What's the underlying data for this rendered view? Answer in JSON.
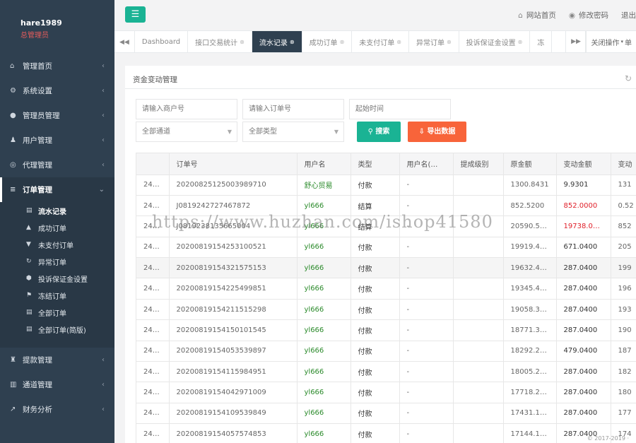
{
  "profile": {
    "name": "hare1989",
    "role": "总管理员"
  },
  "menu": [
    {
      "icon": "home-icon",
      "glyph": "⌂",
      "label": "管理首页"
    },
    {
      "icon": "settings-icon",
      "glyph": "⚙",
      "label": "系统设置"
    },
    {
      "icon": "user-circle-icon",
      "glyph": "●",
      "label": "管理员管理"
    },
    {
      "icon": "users-icon",
      "glyph": "♟",
      "label": "用户管理"
    },
    {
      "icon": "agent-icon",
      "glyph": "◎",
      "label": "代理管理"
    }
  ],
  "orders_menu": {
    "icon": "list-icon",
    "glyph": "≡",
    "label": "订单管理"
  },
  "submenu": [
    {
      "icon": "list-alt-icon",
      "glyph": "▤",
      "label": "流水记录"
    },
    {
      "icon": "thumbs-up-icon",
      "glyph": "▲",
      "label": "成功订单"
    },
    {
      "icon": "thumbs-down-icon",
      "glyph": "▼",
      "label": "未支付订单"
    },
    {
      "icon": "refresh-icon",
      "glyph": "↻",
      "label": "异常订单"
    },
    {
      "icon": "shield-icon",
      "glyph": "⬢",
      "label": "投诉保证金设置"
    },
    {
      "icon": "flag-icon",
      "glyph": "⚑",
      "label": "冻结订单"
    },
    {
      "icon": "list-alt-icon",
      "glyph": "▤",
      "label": "全部订单"
    },
    {
      "icon": "list-alt-icon",
      "glyph": "▤",
      "label": "全部订单(简版)"
    }
  ],
  "menu_bottom": [
    {
      "icon": "withdraw-icon",
      "glyph": "♜",
      "label": "提款管理"
    },
    {
      "icon": "bank-icon",
      "glyph": "▥",
      "label": "通道管理"
    },
    {
      "icon": "chart-icon",
      "glyph": "↗",
      "label": "财务分析"
    }
  ],
  "toplinks": [
    {
      "icon": "home-icon",
      "glyph": "⌂",
      "label": "网站首页"
    },
    {
      "icon": "eye-icon",
      "glyph": "◉",
      "label": "修改密码"
    },
    {
      "label": "退出"
    }
  ],
  "tabs": [
    {
      "label": "Dashboard",
      "closable": false
    },
    {
      "label": "接口交易统计",
      "closable": true
    },
    {
      "label": "流水记录",
      "closable": true
    },
    {
      "label": "成功订单",
      "closable": true
    },
    {
      "label": "未支付订单",
      "closable": true
    },
    {
      "label": "异常订单",
      "closable": true
    },
    {
      "label": "投诉保证金设置",
      "closable": true
    },
    {
      "label": "冻",
      "closable": false
    }
  ],
  "close_ops": "关闭操作",
  "close_ops_tail": "单",
  "panel_title": "资金变动管理",
  "filters": {
    "merchant_placeholder": "请输入商户号",
    "order_placeholder": "请输入订单号",
    "start_placeholder": "起始时间",
    "channel": "全部通道",
    "type": "全部类型",
    "search": "搜索",
    "export": "导出数据"
  },
  "colors": {
    "sidebar": "#2f4050",
    "primary": "#1ab394",
    "export": "#f8643a",
    "red": "#e0202a",
    "green": "#2a8a2a"
  },
  "table": {
    "headers": [
      "",
      "订单号",
      "用户名",
      "类型",
      "用户名(…",
      "提成级别",
      "原金额",
      "变动金额",
      "变动"
    ],
    "rows": [
      [
        "24…",
        "20200825125003989710",
        "舒心贸易",
        "付款",
        "-",
        "",
        "1300.8431",
        "9.9301",
        "131"
      ],
      [
        "24…",
        "J0819242727467872",
        "yl666",
        "结算",
        "-",
        "",
        "852.5200",
        "852.0000",
        "0.52"
      ],
      [
        "24…",
        "J0819238135665004",
        "yl666",
        "结算",
        "-",
        "",
        "20590.5…",
        "19738.0…",
        "852"
      ],
      [
        "24…",
        "20200819154253100521",
        "yl666",
        "付款",
        "-",
        "",
        "19919.4…",
        "671.0400",
        "205"
      ],
      [
        "24…",
        "20200819154321575153",
        "yl666",
        "付款",
        "-",
        "",
        "19632.4…",
        "287.0400",
        "199"
      ],
      [
        "24…",
        "20200819154225499851",
        "yl666",
        "付款",
        "-",
        "",
        "19345.4…",
        "287.0400",
        "196"
      ],
      [
        "24…",
        "20200819154211515298",
        "yl666",
        "付款",
        "-",
        "",
        "19058.3…",
        "287.0400",
        "193"
      ],
      [
        "24…",
        "20200819154150101545",
        "yl666",
        "付款",
        "-",
        "",
        "18771.3…",
        "287.0400",
        "190"
      ],
      [
        "24…",
        "20200819154053539897",
        "yl666",
        "付款",
        "-",
        "",
        "18292.2…",
        "479.0400",
        "187"
      ],
      [
        "24…",
        "20200819154115984951",
        "yl666",
        "付款",
        "-",
        "",
        "18005.2…",
        "287.0400",
        "182"
      ],
      [
        "24…",
        "20200819154042971009",
        "yl666",
        "付款",
        "-",
        "",
        "17718.2…",
        "287.0400",
        "180"
      ],
      [
        "24…",
        "20200819154109539849",
        "yl666",
        "付款",
        "-",
        "",
        "17431.1…",
        "287.0400",
        "177"
      ],
      [
        "24…",
        "20200819154057574853",
        "yl666",
        "付款",
        "-",
        "",
        "17144.1…",
        "287.0400",
        "174"
      ]
    ]
  },
  "watermark": "https://www.huzhan.com/ishop41580",
  "footer": "© 2017-2019 ·"
}
